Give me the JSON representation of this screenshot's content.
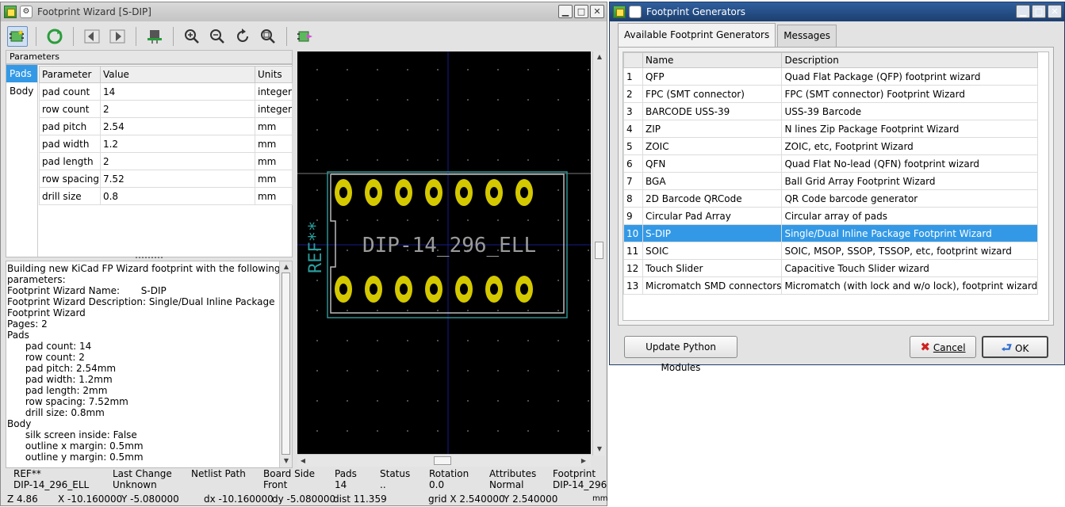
{
  "wizard": {
    "title": "Footprint Wizard [S-DIP]",
    "params_header": "Parameters",
    "side_tabs": [
      "Pads",
      "Body"
    ],
    "columns": [
      "Parameter",
      "Value",
      "Units"
    ],
    "rows": [
      {
        "param": "pad count",
        "value": "14",
        "units": "integer"
      },
      {
        "param": "row count",
        "value": "2",
        "units": "integer"
      },
      {
        "param": "pad pitch",
        "value": "2.54",
        "units": "mm"
      },
      {
        "param": "pad width",
        "value": "1.2",
        "units": "mm"
      },
      {
        "param": "pad length",
        "value": "2",
        "units": "mm"
      },
      {
        "param": "row spacing",
        "value": "7.52",
        "units": "mm"
      },
      {
        "param": "drill size",
        "value": "0.8",
        "units": "mm"
      }
    ],
    "messages": "Building new KiCad FP Wizard footprint with the following\nparameters:\nFootprint Wizard Name:       S-DIP\nFootprint Wizard Description: Single/Dual Inline Package\nFootprint Wizard\nPages: 2\nPads\n      pad count: 14\n      row count: 2\n      pad pitch: 2.54mm\n      pad width: 1.2mm\n      pad length: 2mm\n      row spacing: 7.52mm\n      drill size: 0.8mm\nBody\n      silk screen inside: False\n      outline x margin: 0.5mm\n      outline y margin: 0.5mm",
    "canvas": {
      "footprint_value": "DIP-14_296_ELL",
      "reference": "REF**"
    },
    "status": [
      {
        "label": "REF**",
        "value": "DIP-14_296_ELL"
      },
      {
        "label": "Last Change",
        "value": "Unknown"
      },
      {
        "label": "Netlist Path",
        "value": ""
      },
      {
        "label": "Board Side",
        "value": "Front"
      },
      {
        "label": "Pads",
        "value": "14"
      },
      {
        "label": "Status",
        "value": ".."
      },
      {
        "label": "Rotation",
        "value": "0.0"
      },
      {
        "label": "Attributes",
        "value": "Normal"
      },
      {
        "label": "Footprint",
        "value": "DIP-14_296"
      }
    ],
    "coords": {
      "zoom": "Z 4.86",
      "x": "X -10.160000",
      "y": "Y -5.080000",
      "dx": "dx -10.160000",
      "dy": "dy -5.080000",
      "dist": "dist 11.359",
      "grid_x": "grid X 2.540000",
      "grid_y": "Y 2.540000",
      "units": "mm"
    }
  },
  "generators": {
    "title": "Footprint Generators",
    "tabs": [
      "Available Footprint Generators",
      "Messages"
    ],
    "columns": [
      "Name",
      "Description"
    ],
    "rows": [
      {
        "n": "1",
        "name": "QFP",
        "desc": "Quad Flat Package (QFP) footprint wizard"
      },
      {
        "n": "2",
        "name": "FPC (SMT connector)",
        "desc": "FPC (SMT connector) Footprint Wizard"
      },
      {
        "n": "3",
        "name": "BARCODE USS-39",
        "desc": "USS-39 Barcode"
      },
      {
        "n": "4",
        "name": "ZIP",
        "desc": "N lines Zip Package Footprint Wizard"
      },
      {
        "n": "5",
        "name": "ZOIC",
        "desc": "ZOIC, etc, Footprint Wizard"
      },
      {
        "n": "6",
        "name": "QFN",
        "desc": "Quad Flat No-lead (QFN) footprint wizard"
      },
      {
        "n": "7",
        "name": "BGA",
        "desc": "Ball Grid Array Footprint Wizard"
      },
      {
        "n": "8",
        "name": "2D Barcode QRCode",
        "desc": "QR Code barcode generator"
      },
      {
        "n": "9",
        "name": "Circular Pad Array",
        "desc": "Circular array of pads"
      },
      {
        "n": "10",
        "name": "S-DIP",
        "desc": "Single/Dual Inline Package Footprint Wizard"
      },
      {
        "n": "11",
        "name": "SOIC",
        "desc": "SOIC, MSOP, SSOP, TSSOP, etc, footprint wizard"
      },
      {
        "n": "12",
        "name": "Touch Slider",
        "desc": "Capacitive Touch Slider wizard"
      },
      {
        "n": "13",
        "name": "Micromatch SMD connectors",
        "desc": "Micromatch (with lock and w/o lock), footprint wizard"
      }
    ],
    "selected_index": 9,
    "update_label": "Update Python Modules",
    "cancel_label": "Cancel",
    "ok_label": "OK"
  }
}
